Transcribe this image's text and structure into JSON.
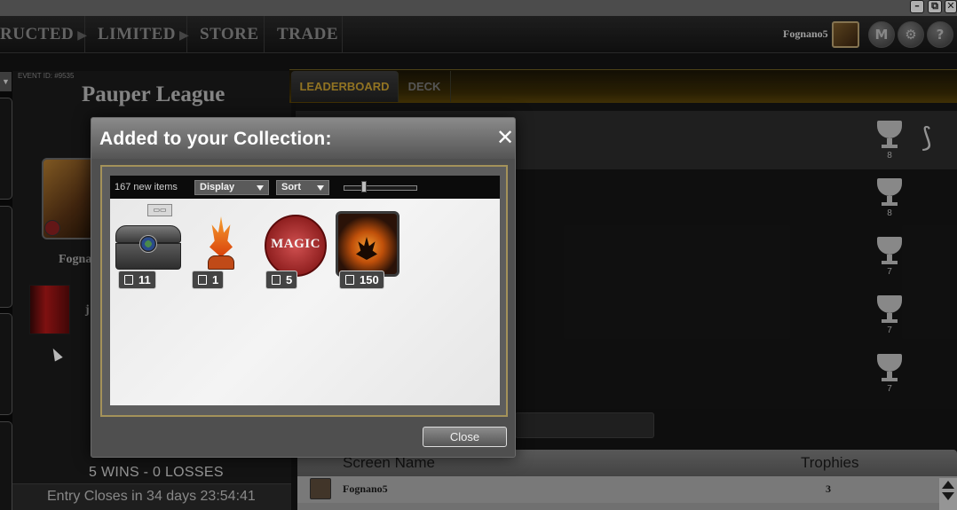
{
  "window_controls": [
    "–",
    "⧉",
    "✕"
  ],
  "nav": {
    "tabs": [
      {
        "label": "RUCTED",
        "arrow": "▶"
      },
      {
        "label": "LIMITED",
        "arrow": "▶"
      },
      {
        "label": "STORE",
        "arrow": ""
      },
      {
        "label": "TRADE",
        "arrow": ""
      }
    ],
    "username": "Fognano5",
    "buttons": [
      {
        "glyph": "M",
        "icon": "mana-icon"
      },
      {
        "glyph": "⚙",
        "icon": "gear-icon"
      },
      {
        "glyph": "?",
        "icon": "help-icon"
      }
    ]
  },
  "event": {
    "dropdown_glyph": "▼",
    "id": "EVENT ID: #9535",
    "title": "Pauper League",
    "player_name": "Fogna",
    "deck_initial": "j",
    "record": "5 WINS - 0 LOSSES",
    "entry_closes": "Entry Closes in 34 days 23:54:41"
  },
  "tabs": {
    "leaderboard": "LEADERBOARD",
    "deck": "DECK"
  },
  "leaderboard": {
    "trophy_counts": [
      "8",
      "8",
      "7",
      "7",
      "7"
    ],
    "brand_glyph": "⟆",
    "table": {
      "headers": {
        "screen_name": "Screen Name",
        "trophies": "Trophies"
      },
      "rows": [
        {
          "name": "Fognano5",
          "trophies": "3"
        }
      ]
    }
  },
  "modal": {
    "title": "Added to your Collection:",
    "close_glyph": "✕",
    "new_items": "167 new items",
    "display_label": "Display",
    "sort_label": "Sort",
    "chest_tag": "▭▭",
    "token_text": "MAGIC",
    "items": [
      {
        "name": "treasure-chest",
        "qty": "11"
      },
      {
        "name": "planeswalker-spark",
        "qty": "1"
      },
      {
        "name": "magic-token",
        "qty": "5"
      },
      {
        "name": "booster-pack",
        "qty": "150"
      }
    ],
    "close_label": "Close"
  }
}
